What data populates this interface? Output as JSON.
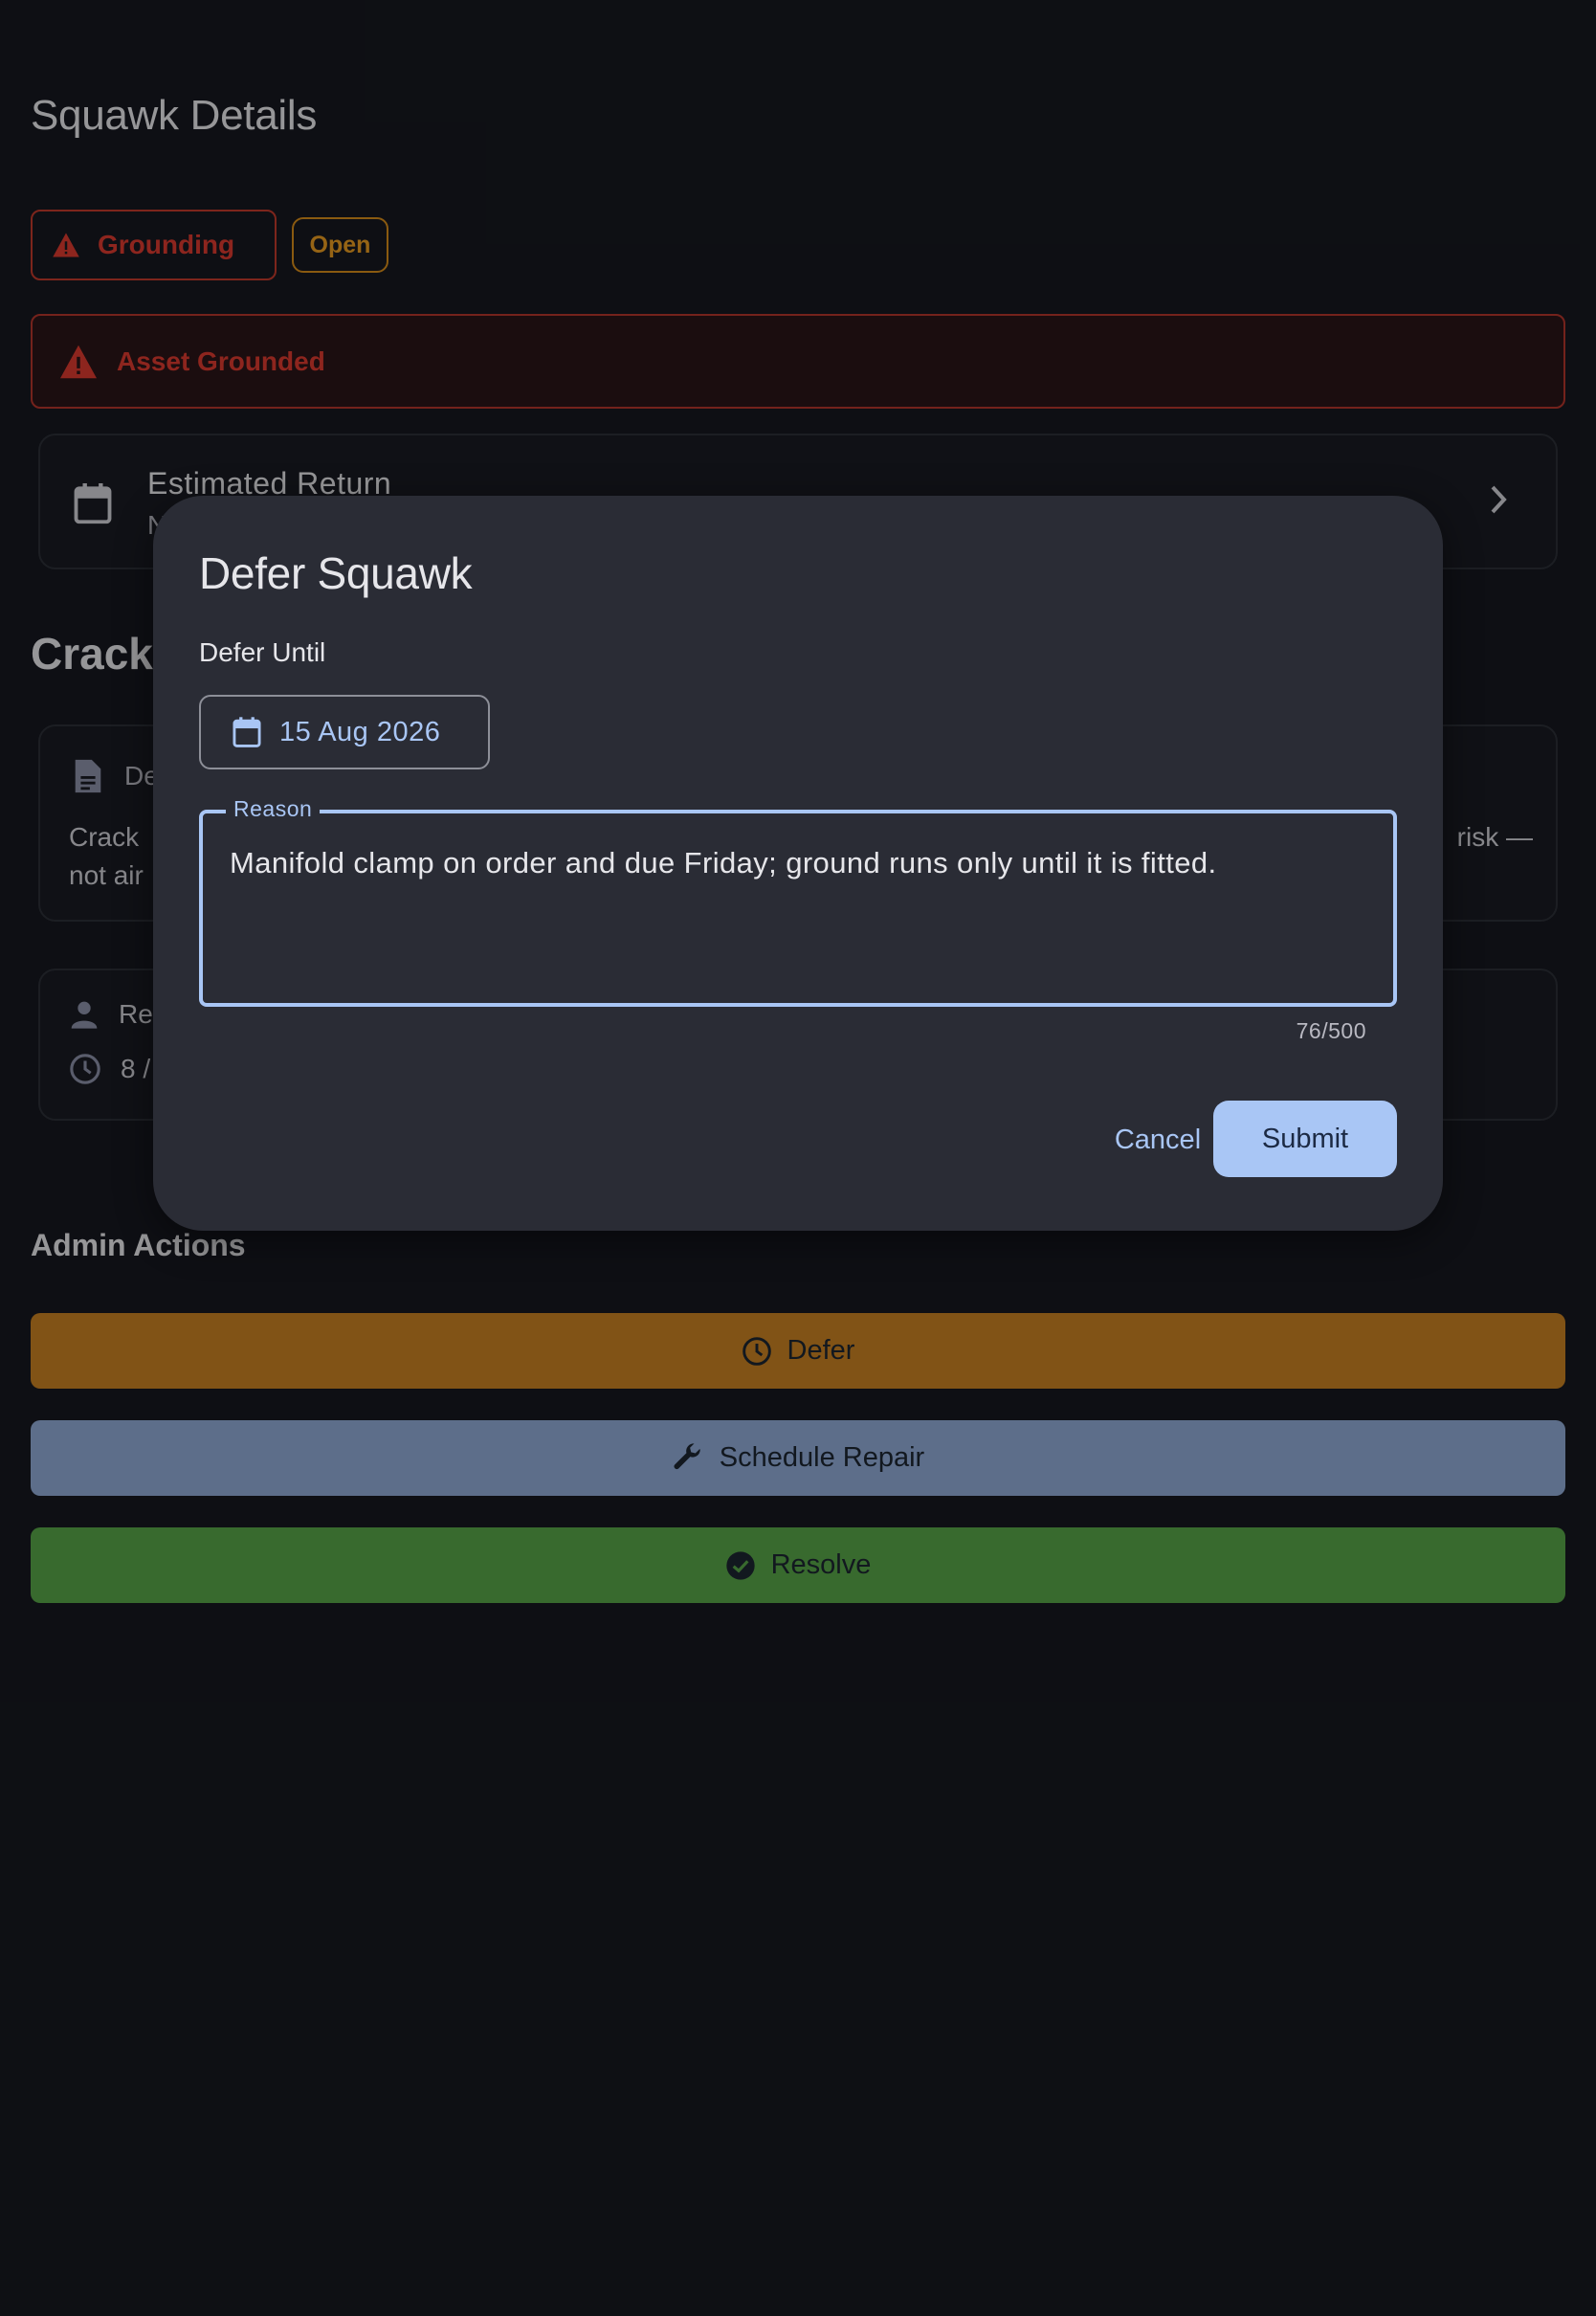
{
  "page": {
    "title": "Squawk Details",
    "severity_chip": "Grounding",
    "status_chip": "Open",
    "grounded_banner": "Asset Grounded",
    "estimated_return": {
      "label": "Estimated Return",
      "value": "N"
    },
    "squawk_title": "Crack",
    "description_card": {
      "heading": "De",
      "text_line1": "Crack",
      "text_line1_end": "risk —",
      "text_line2": "not air"
    },
    "meta_card": {
      "reporter": "Re",
      "time": "8 /"
    },
    "admin": {
      "heading": "Admin Actions",
      "defer_label": "Defer",
      "repair_label": "Schedule Repair",
      "resolve_label": "Resolve"
    }
  },
  "dialog": {
    "title": "Defer Squawk",
    "defer_until_label": "Defer Until",
    "date_value": "15 Aug 2026",
    "reason_label": "Reason",
    "reason_value": "Manifold clamp on order and due Friday; ground runs only until it is fitted.",
    "counter": "76/500",
    "cancel_label": "Cancel",
    "submit_label": "Submit"
  },
  "colors": {
    "background": "#16181f",
    "grounding_red": "#d93a2e",
    "open_amber": "#e69a21",
    "defer_button": "#c78022",
    "repair_button": "#8fa9d4",
    "resolve_button": "#56a447",
    "accent_blue": "#a9c6f5",
    "dialog_surface": "#2a2c35"
  },
  "icons": {
    "severity": "warning-icon",
    "estimated_return": "calendar-icon",
    "chevron": "chevron-right-icon",
    "description": "document-icon",
    "reporter": "person-icon",
    "time": "clock-icon",
    "defer": "clock-icon",
    "repair": "wrench-icon",
    "resolve": "check-circle-icon",
    "date": "calendar-icon"
  }
}
